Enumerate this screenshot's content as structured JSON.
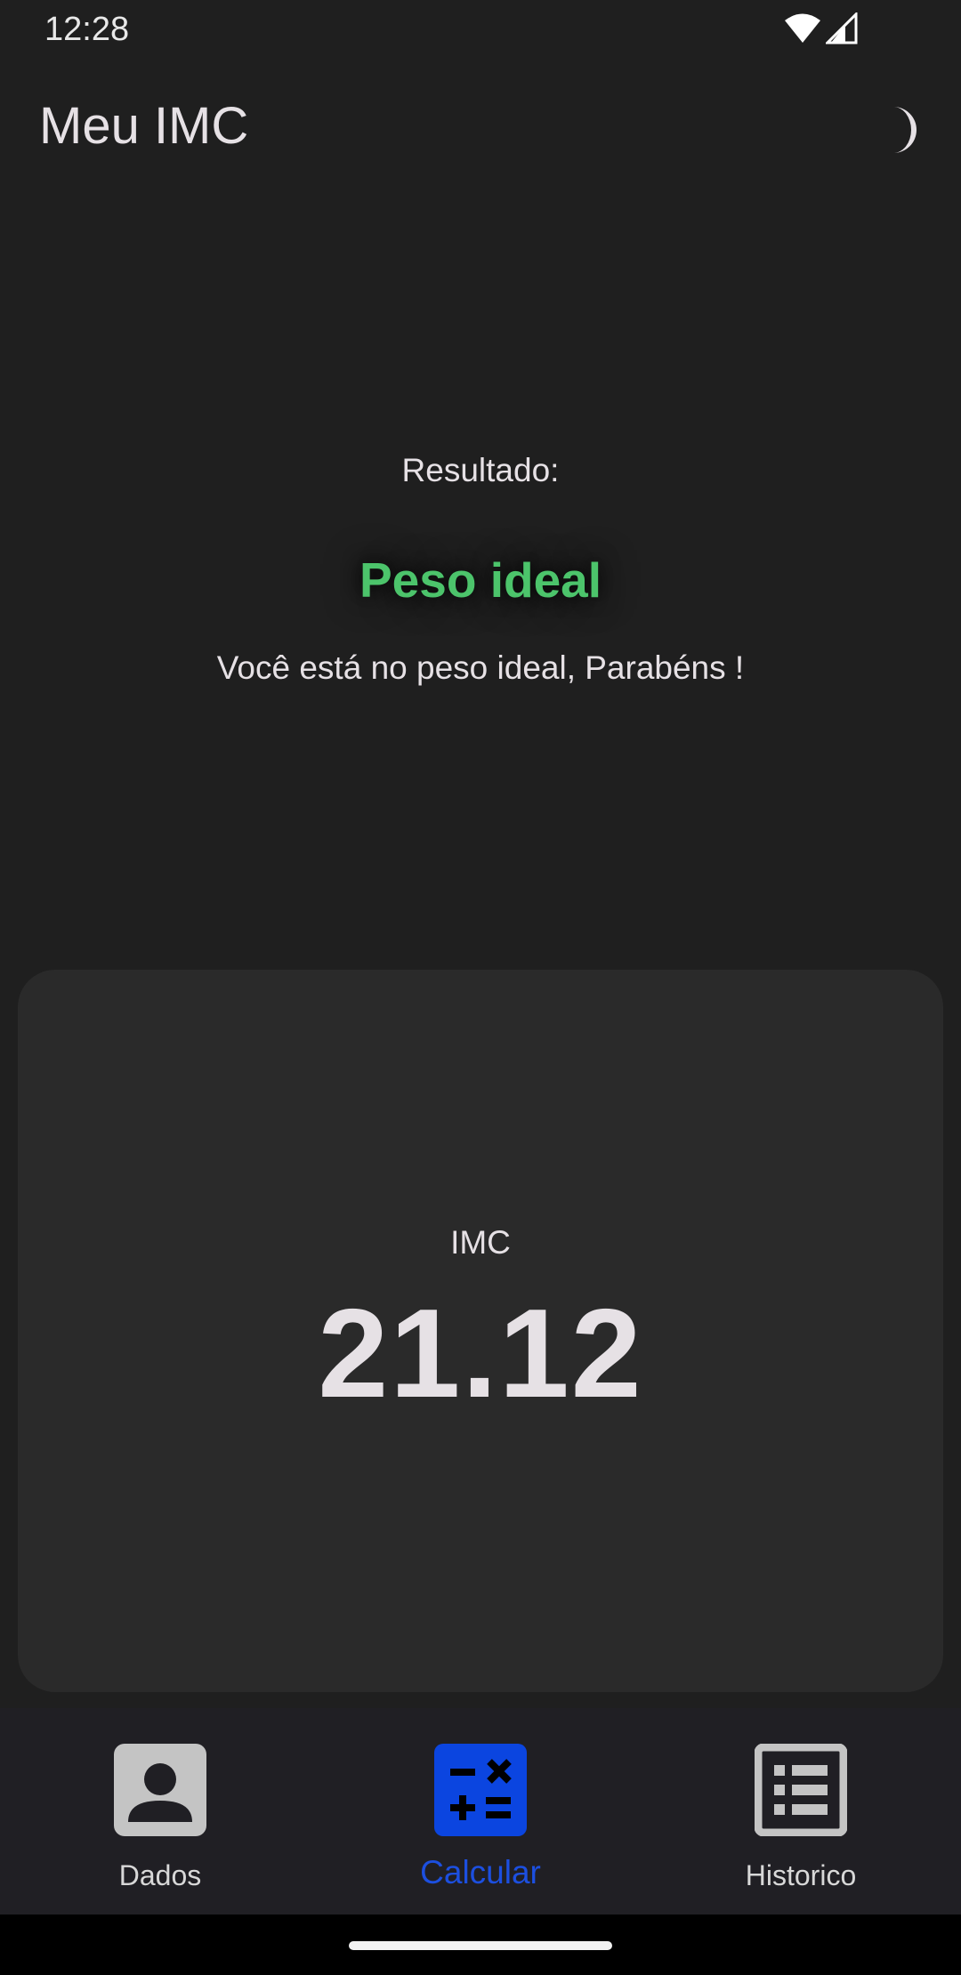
{
  "status_bar": {
    "time": "12:28",
    "icons": [
      "wifi-icon",
      "signal-icon"
    ]
  },
  "app_bar": {
    "title": "Meu IMC",
    "theme_icon": "moon-icon"
  },
  "result": {
    "label": "Resultado:",
    "status": "Peso ideal",
    "status_color": "#4cc46b",
    "message": "Você está no peso ideal, Parabéns !"
  },
  "imc_card": {
    "label": "IMC",
    "value": "21.12"
  },
  "bottom_nav": {
    "items": [
      {
        "label": "Dados",
        "icon": "person-icon",
        "active": false
      },
      {
        "label": "Calcular",
        "icon": "calculator-icon",
        "active": true
      },
      {
        "label": "Historico",
        "icon": "list-icon",
        "active": false
      }
    ]
  },
  "colors": {
    "background": "#1f1f1f",
    "card": "#2a2a2a",
    "accent": "#0b45e0",
    "inactive_icon": "#c4c4c4",
    "text": "#e6e1e5"
  }
}
